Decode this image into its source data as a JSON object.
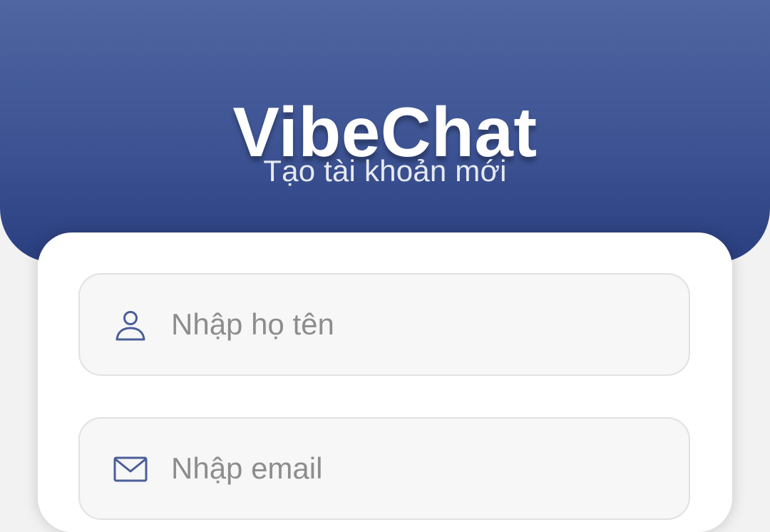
{
  "header": {
    "app_title": "VibeChat",
    "subtitle": "Tạo tài khoản mới"
  },
  "form": {
    "name_field": {
      "icon": "user-icon",
      "placeholder": "Nhập họ tên",
      "value": ""
    },
    "email_field": {
      "icon": "envelope-icon",
      "placeholder": "Nhập email",
      "value": ""
    }
  },
  "colors": {
    "header_top": "#4f66a2",
    "header_bottom": "#2a3f80",
    "icon": "#4a5f98",
    "field_background": "#f7f7f7",
    "page_background": "#f2f2f3"
  }
}
